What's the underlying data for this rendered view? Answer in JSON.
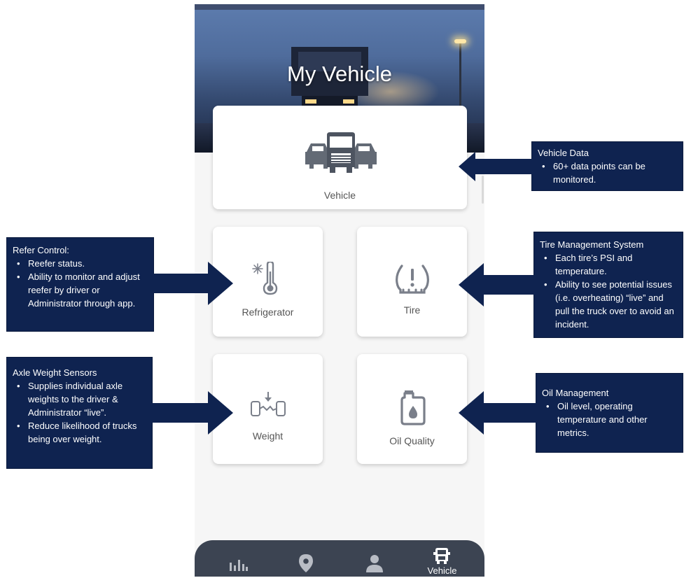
{
  "screen": {
    "title": "My Vehicle",
    "cards": {
      "vehicle": {
        "label": "Vehicle",
        "icon": "truck-fleet-icon"
      },
      "refrigerator": {
        "label": "Refrigerator",
        "icon": "thermometer-snowflake-icon"
      },
      "tire": {
        "label": "Tire",
        "icon": "tire-pressure-warning-icon"
      },
      "weight": {
        "label": "Weight",
        "icon": "axle-weight-icon"
      },
      "oil": {
        "label": "Oil Quality",
        "icon": "oil-can-icon"
      }
    },
    "bottom_nav": {
      "items": [
        {
          "icon": "bar-chart-icon",
          "label": ""
        },
        {
          "icon": "location-pin-icon",
          "label": ""
        },
        {
          "icon": "person-icon",
          "label": ""
        },
        {
          "icon": "truck-icon",
          "label": "Vehicle",
          "active": true
        }
      ]
    }
  },
  "annotations": {
    "vehicle_data": {
      "title": "Vehicle Data",
      "bullets": [
        "60+ data points can be monitored."
      ]
    },
    "refer_control": {
      "title": "Refer Control:",
      "bullets": [
        "Reefer status.",
        "Ability to monitor and adjust reefer by driver or Administrator through app."
      ]
    },
    "tire_management": {
      "title": "Tire Management System",
      "bullets": [
        "Each tire’s PSI and temperature.",
        "Ability to see potential issues (i.e. overheating) “live” and pull the truck over to avoid an incident."
      ]
    },
    "axle_weight": {
      "title": "Axle Weight Sensors",
      "bullets": [
        "Supplies individual axle weights to the driver & Administrator “live”.",
        "Reduce likelihood of trucks being over weight."
      ]
    },
    "oil_management": {
      "title": "Oil Management",
      "bullets": [
        "Oil level, operating temperature and other metrics."
      ]
    }
  },
  "colors": {
    "callout_bg": "#0f2350",
    "card_bg": "#ffffff",
    "icon_gray": "#7a7f8a",
    "nav_bg": "#3c4452"
  }
}
